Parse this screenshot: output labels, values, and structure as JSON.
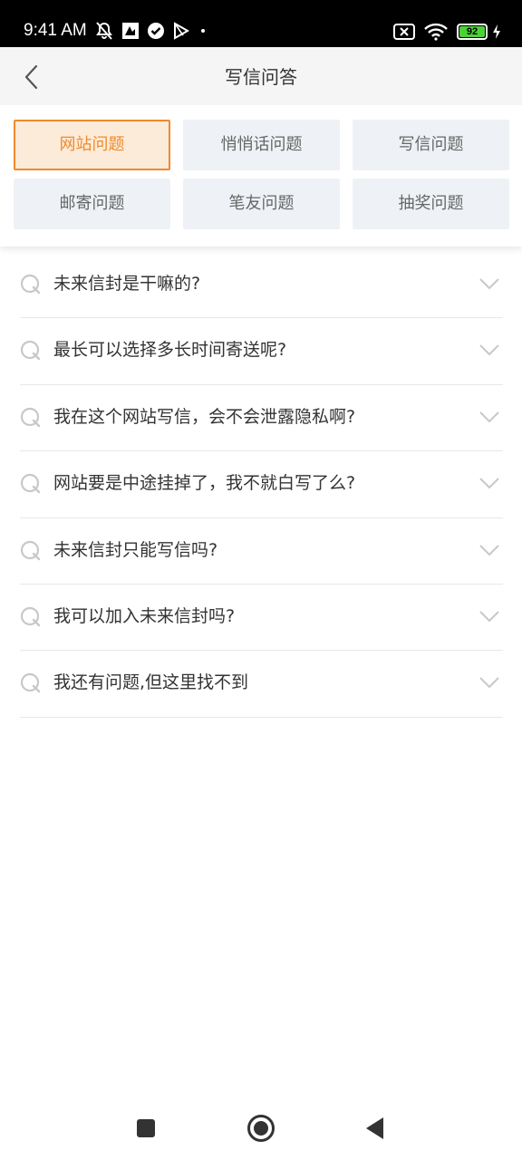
{
  "status_bar": {
    "time": "9:41 AM",
    "battery": "92",
    "icons": [
      "mute-icon",
      "app-icon",
      "check-icon",
      "play-icon",
      "dot-icon",
      "sim-off-icon",
      "wifi-icon",
      "battery-icon",
      "charging-icon"
    ]
  },
  "header": {
    "title": "写信问答",
    "back_icon": "chevron-left-icon"
  },
  "categories": [
    {
      "label": "网站问题",
      "active": true
    },
    {
      "label": "悄悄话问题",
      "active": false
    },
    {
      "label": "写信问题",
      "active": false
    },
    {
      "label": "邮寄问题",
      "active": false
    },
    {
      "label": "笔友问题",
      "active": false
    },
    {
      "label": "抽奖问题",
      "active": false
    }
  ],
  "faq": [
    {
      "question": "未来信封是干嘛的?"
    },
    {
      "question": "最长可以选择多长时间寄送呢?"
    },
    {
      "question": "我在这个网站写信，会不会泄露隐私啊?"
    },
    {
      "question": "网站要是中途挂掉了，我不就白写了么?"
    },
    {
      "question": "未来信封只能写信吗?"
    },
    {
      "question": "我可以加入未来信封吗?"
    },
    {
      "question": "我还有问题,但这里找不到"
    }
  ],
  "colors": {
    "accent": "#f08a2c",
    "accent_bg": "#fdebd9",
    "button_bg": "#eef2f6",
    "header_bg": "#f5f5f5"
  },
  "nav_bar": {
    "icons": [
      "recent-apps-icon",
      "home-icon",
      "back-icon"
    ]
  }
}
